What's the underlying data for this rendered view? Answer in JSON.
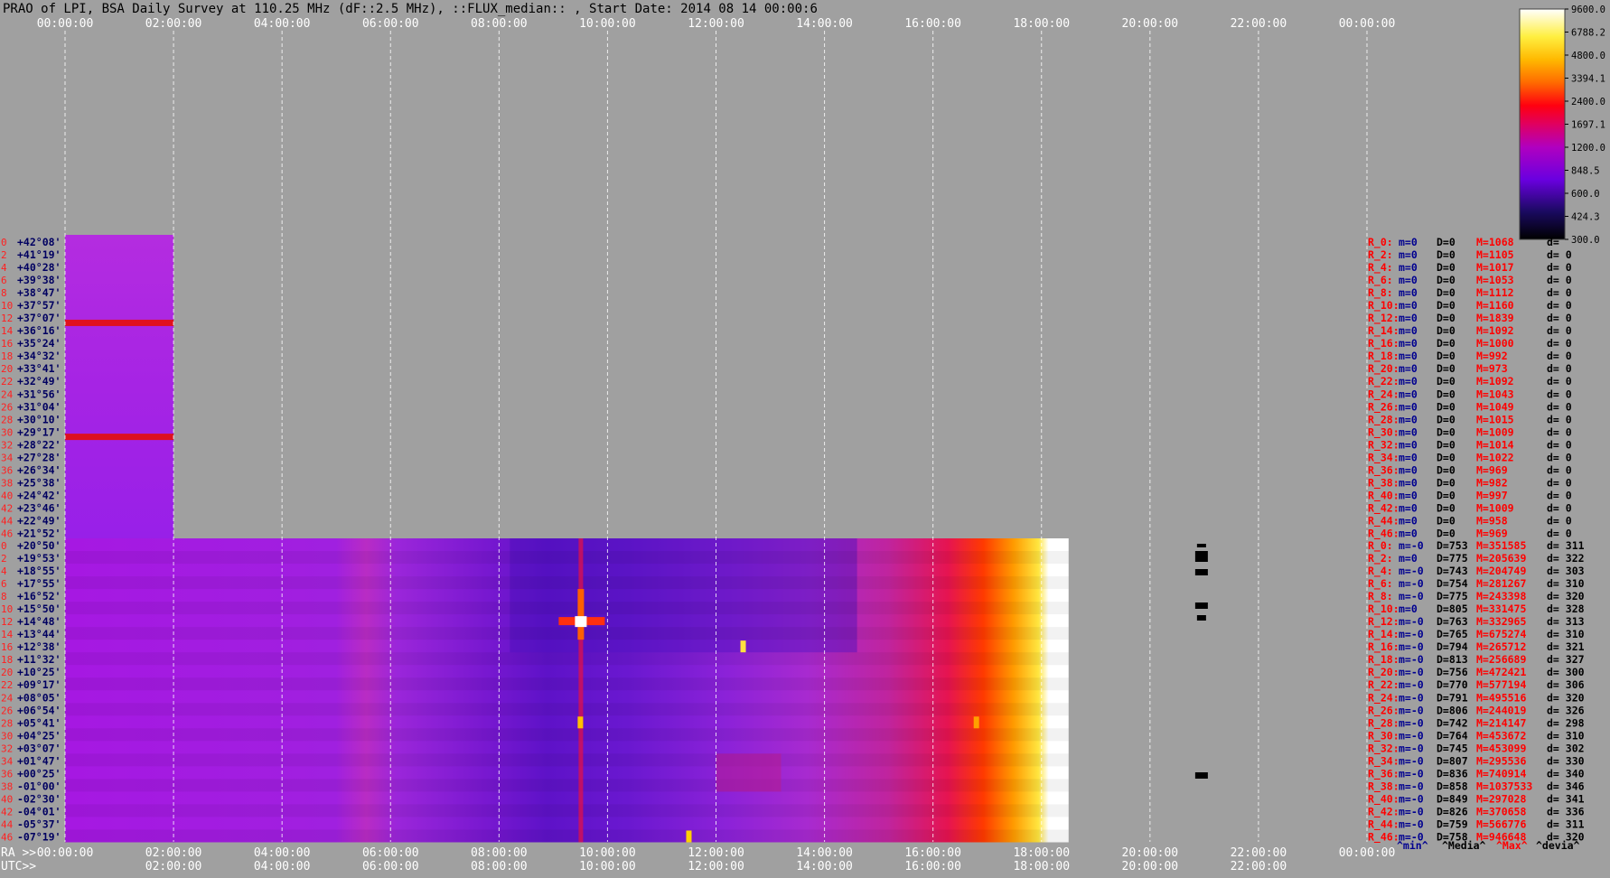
{
  "chart_data": {
    "type": "heatmap",
    "title": "PRAO of LPI, BSA Daily Survey at 110.25 MHz (dF::2.5 MHz), ::FLUX_median:: , Start Date: 2014 08 14 00:00:6",
    "x_axis": {
      "top_ticks": [
        "00:00:00",
        "02:00:00",
        "04:00:00",
        "06:00:00",
        "08:00:00",
        "10:00:00",
        "12:00:00",
        "14:00:00",
        "16:00:00",
        "18:00:00",
        "20:00:00",
        "22:00:00",
        "00:00:00"
      ],
      "ra_label": "RA >>",
      "ra_ticks": [
        "00:00:00",
        "02:00:00",
        "04:00:00",
        "06:00:00",
        "08:00:00",
        "10:00:00",
        "12:00:00",
        "14:00:00",
        "16:00:00",
        "18:00:00",
        "20:00:00",
        "22:00:00",
        "00:00:00"
      ],
      "utc_label": "UTC>>",
      "utc_ticks": [
        "02:00:00",
        "04:00:00",
        "06:00:00",
        "08:00:00",
        "10:00:00",
        "12:00:00",
        "14:00:00",
        "16:00:00",
        "18:00:00",
        "20:00:00",
        "22:00:00"
      ],
      "hour_range": [
        0,
        24
      ],
      "grid": true
    },
    "colorbar": {
      "ticks": [
        9600.0,
        6788.2,
        4800.0,
        3394.1,
        2400.0,
        1697.1,
        1200.0,
        848.5,
        600.0,
        424.3,
        300.0
      ],
      "tick_labels": [
        "9600.0",
        "6788.2",
        "4800.0",
        "3394.1",
        "2400.0",
        "1697.1",
        "1200.0",
        "848.5",
        "600.0",
        "424.3",
        "300.0"
      ],
      "scale": "log",
      "range": [
        300,
        9600
      ]
    },
    "upper_block": {
      "hour_range": [
        0,
        2
      ],
      "rows": [
        "0",
        "2",
        "4",
        "6",
        "8",
        "10",
        "12",
        "14",
        "16",
        "18",
        "20",
        "22",
        "24",
        "26",
        "28",
        "30",
        "32",
        "34",
        "36",
        "38",
        "40",
        "42",
        "44",
        "46"
      ],
      "dec": [
        "+42°08'",
        "+41°19'",
        "+40°28'",
        "+39°38'",
        "+38°47'",
        "+37°57'",
        "+37°07'",
        "+36°16'",
        "+35°24'",
        "+34°32'",
        "+33°41'",
        "+32°49'",
        "+31°56'",
        "+31°04'",
        "+30°10'",
        "+29°17'",
        "+28°22'",
        "+27°28'",
        "+26°34'",
        "+25°38'",
        "+24°42'",
        "+23°46'",
        "+22°49'",
        "+21°52'"
      ],
      "stats": [
        {
          "r": "R_0:",
          "m": "m=0",
          "D": "D=0",
          "M": "M=1068",
          "d": "d="
        },
        {
          "r": "R_2:",
          "m": "m=0",
          "D": "D=0",
          "M": "M=1105",
          "d": "d= 0"
        },
        {
          "r": "R_4:",
          "m": "m=0",
          "D": "D=0",
          "M": "M=1017",
          "d": "d= 0"
        },
        {
          "r": "R_6:",
          "m": "m=0",
          "D": "D=0",
          "M": "M=1053",
          "d": "d= 0"
        },
        {
          "r": "R_8:",
          "m": "m=0",
          "D": "D=0",
          "M": "M=1112",
          "d": "d= 0"
        },
        {
          "r": "R_10:",
          "m": "m=0",
          "D": "D=0",
          "M": "M=1160",
          "d": "d= 0"
        },
        {
          "r": "R_12:",
          "m": "m=0",
          "D": "D=0",
          "M": "M=1839",
          "d": "d= 0"
        },
        {
          "r": "R_14:",
          "m": "m=0",
          "D": "D=0",
          "M": "M=1092",
          "d": "d= 0"
        },
        {
          "r": "R_16:",
          "m": "m=0",
          "D": "D=0",
          "M": "M=1000",
          "d": "d= 0"
        },
        {
          "r": "R_18:",
          "m": "m=0",
          "D": "D=0",
          "M": "M=992",
          "d": "d= 0"
        },
        {
          "r": "R_20:",
          "m": "m=0",
          "D": "D=0",
          "M": "M=973",
          "d": "d= 0"
        },
        {
          "r": "R_22:",
          "m": "m=0",
          "D": "D=0",
          "M": "M=1092",
          "d": "d= 0"
        },
        {
          "r": "R_24:",
          "m": "m=0",
          "D": "D=0",
          "M": "M=1043",
          "d": "d= 0"
        },
        {
          "r": "R_26:",
          "m": "m=0",
          "D": "D=0",
          "M": "M=1049",
          "d": "d= 0"
        },
        {
          "r": "R_28:",
          "m": "m=0",
          "D": "D=0",
          "M": "M=1015",
          "d": "d= 0"
        },
        {
          "r": "R_30:",
          "m": "m=0",
          "D": "D=0",
          "M": "M=1009",
          "d": "d= 0"
        },
        {
          "r": "R_32:",
          "m": "m=0",
          "D": "D=0",
          "M": "M=1014",
          "d": "d= 0"
        },
        {
          "r": "R_34:",
          "m": "m=0",
          "D": "D=0",
          "M": "M=1022",
          "d": "d= 0"
        },
        {
          "r": "R_36:",
          "m": "m=0",
          "D": "D=0",
          "M": "M=969",
          "d": "d= 0"
        },
        {
          "r": "R_38:",
          "m": "m=0",
          "D": "D=0",
          "M": "M=982",
          "d": "d= 0"
        },
        {
          "r": "R_40:",
          "m": "m=0",
          "D": "D=0",
          "M": "M=997",
          "d": "d= 0"
        },
        {
          "r": "R_42:",
          "m": "m=0",
          "D": "D=0",
          "M": "M=1009",
          "d": "d= 0"
        },
        {
          "r": "R_44:",
          "m": "m=0",
          "D": "D=0",
          "M": "M=958",
          "d": "d= 0"
        },
        {
          "r": "R_46:",
          "m": "m=0",
          "D": "D=0",
          "M": "M=969",
          "d": "d= 0"
        }
      ]
    },
    "lower_block": {
      "hour_range": [
        0,
        18.5
      ],
      "rows": [
        "0",
        "2",
        "4",
        "6",
        "8",
        "10",
        "12",
        "14",
        "16",
        "18",
        "20",
        "22",
        "24",
        "26",
        "28",
        "30",
        "32",
        "34",
        "36",
        "38",
        "40",
        "42",
        "44",
        "46"
      ],
      "dec": [
        "+20°50'",
        "+19°53'",
        "+18°55'",
        "+17°55'",
        "+16°52'",
        "+15°50'",
        "+14°48'",
        "+13°44'",
        "+12°38'",
        "+11°32'",
        "+10°25'",
        "+09°17'",
        "+08°05'",
        "+06°54'",
        "+05°41'",
        "+04°25'",
        "+03°07'",
        "+01°47'",
        "+00°25'",
        "-01°00'",
        "-02°30'",
        "-04°01'",
        "-05°37'",
        "-07°19'"
      ],
      "stats": [
        {
          "r": "R_0:",
          "m": "m=-0",
          "D": "D=753",
          "M": "M=351585",
          "d": "d= 311"
        },
        {
          "r": "R_2:",
          "m": "m=0",
          "D": "D=775",
          "M": "M=205639",
          "d": "d= 322"
        },
        {
          "r": "R_4:",
          "m": "m=-0",
          "D": "D=743",
          "M": "M=204749",
          "d": "d= 303"
        },
        {
          "r": "R_6:",
          "m": "m=-0",
          "D": "D=754",
          "M": "M=281267",
          "d": "d= 310"
        },
        {
          "r": "R_8:",
          "m": "m=-0",
          "D": "D=775",
          "M": "M=243398",
          "d": "d= 320"
        },
        {
          "r": "R_10:",
          "m": "m=0",
          "D": "D=805",
          "M": "M=331475",
          "d": "d= 328"
        },
        {
          "r": "R_12:",
          "m": "m=-0",
          "D": "D=763",
          "M": "M=332965",
          "d": "d= 313"
        },
        {
          "r": "R_14:",
          "m": "m=-0",
          "D": "D=765",
          "M": "M=675274",
          "d": "d= 310"
        },
        {
          "r": "R_16:",
          "m": "m=-0",
          "D": "D=794",
          "M": "M=265712",
          "d": "d= 321"
        },
        {
          "r": "R_18:",
          "m": "m=-0",
          "D": "D=813",
          "M": "M=256689",
          "d": "d= 327"
        },
        {
          "r": "R_20:",
          "m": "m=-0",
          "D": "D=756",
          "M": "M=472421",
          "d": "d= 300"
        },
        {
          "r": "R_22:",
          "m": "m=-0",
          "D": "D=770",
          "M": "M=577194",
          "d": "d= 306"
        },
        {
          "r": "R_24:",
          "m": "m=-0",
          "D": "D=791",
          "M": "M=495516",
          "d": "d= 320"
        },
        {
          "r": "R_26:",
          "m": "m=-0",
          "D": "D=806",
          "M": "M=244019",
          "d": "d= 326"
        },
        {
          "r": "R_28:",
          "m": "m=-0",
          "D": "D=742",
          "M": "M=214147",
          "d": "d= 298"
        },
        {
          "r": "R_30:",
          "m": "m=-0",
          "D": "D=764",
          "M": "M=453672",
          "d": "d= 310"
        },
        {
          "r": "R_32:",
          "m": "m=-0",
          "D": "D=745",
          "M": "M=453099",
          "d": "d= 302"
        },
        {
          "r": "R_34:",
          "m": "m=-0",
          "D": "D=807",
          "M": "M=295536",
          "d": "d= 330"
        },
        {
          "r": "R_36:",
          "m": "m=-0",
          "D": "D=836",
          "M": "M=740914",
          "d": "d= 340"
        },
        {
          "r": "R_38:",
          "m": "m=-0",
          "D": "D=858",
          "M": "M=1037533",
          "d": "d= 346"
        },
        {
          "r": "R_40:",
          "m": "m=-0",
          "D": "D=849",
          "M": "M=297028",
          "d": "d= 341"
        },
        {
          "r": "R_42:",
          "m": "m=-0",
          "D": "D=826",
          "M": "M=370658",
          "d": "d= 336"
        },
        {
          "r": "R_44:",
          "m": "m=-0",
          "D": "D=759",
          "M": "M=566776",
          "d": "d= 311"
        },
        {
          "r": "R_46:",
          "m": "m=-0",
          "D": "D=758",
          "M": "M=946648",
          "d": "d= 320"
        }
      ]
    },
    "stats_footer": [
      "^min^",
      "^Media^",
      "^Max^",
      "^devia^"
    ],
    "colors": {
      "background": "#a0a0a0",
      "row_number": "#ff2020",
      "dec_label": "#000060",
      "stat_R": "#ff0000",
      "stat_m": "#000090",
      "stat_D": "#000000",
      "stat_M": "#ff0000",
      "grid": "#ffffff"
    }
  }
}
